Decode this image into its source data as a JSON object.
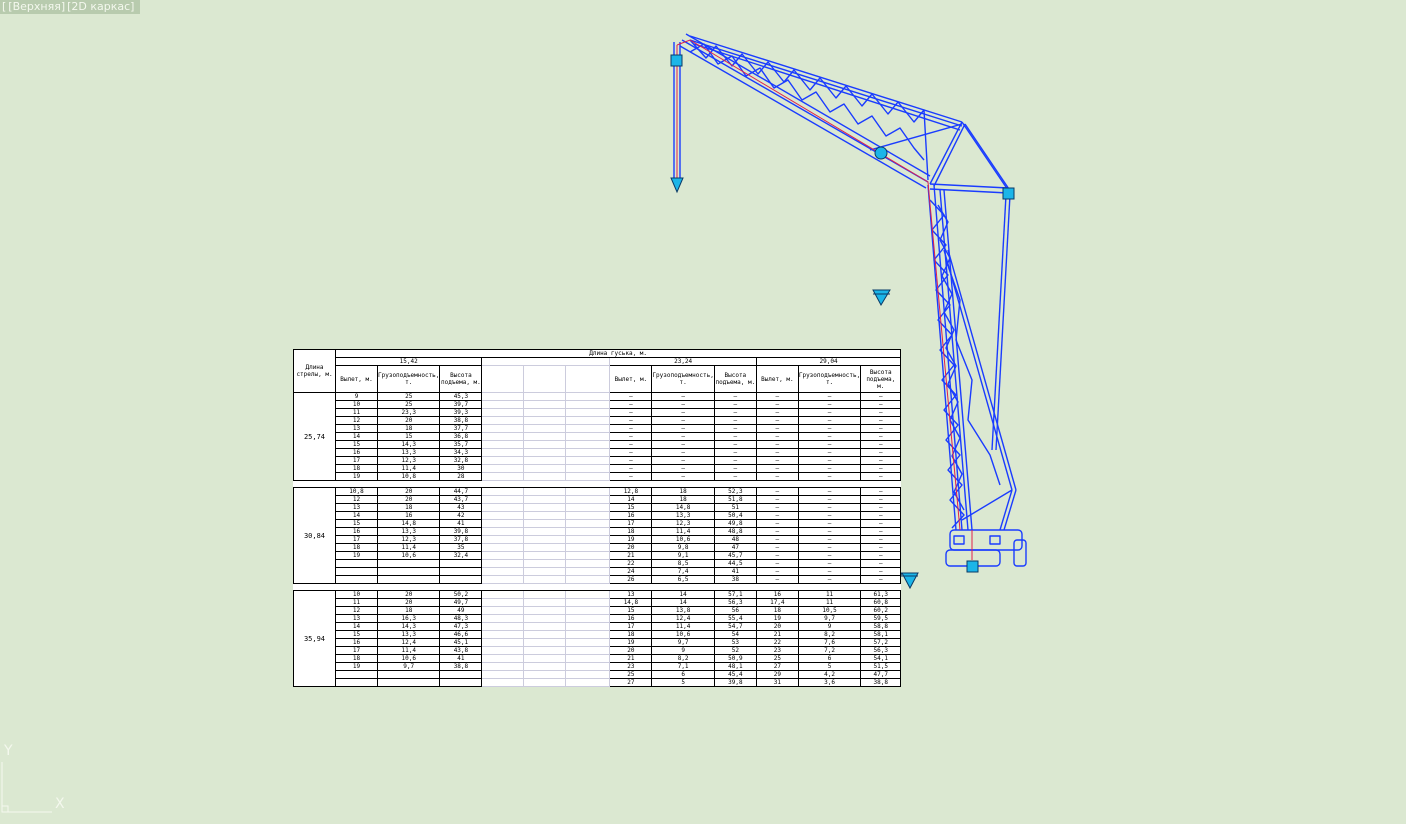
{
  "viewport": {
    "prefix": "[",
    "view": "[Верхняя]",
    "style": "[2D каркас]"
  },
  "colors": {
    "background": "#dbe8d1",
    "crane_lines": "#1a3cff",
    "cable": "#e0204a",
    "markers": "#1bb5e8"
  },
  "table": {
    "col1_header": "Длина стрелы, м.",
    "top_header": "Длина гуська, м.",
    "jib_lengths": [
      "15,42",
      "23,24",
      "29,04"
    ],
    "sub_headers": [
      "Вылет, м.",
      "Грузоподъемность, т.",
      "Высота подъема, м."
    ],
    "groups": [
      {
        "boom": "25,74",
        "rows": [
          [
            "9",
            "25",
            "45,3",
            "—",
            "—",
            "—",
            "—",
            "—",
            "—"
          ],
          [
            "10",
            "25",
            "39,7",
            "—",
            "—",
            "—",
            "—",
            "—",
            "—"
          ],
          [
            "11",
            "23,3",
            "39,3",
            "—",
            "—",
            "—",
            "—",
            "—",
            "—"
          ],
          [
            "12",
            "20",
            "38,8",
            "—",
            "—",
            "—",
            "—",
            "—",
            "—"
          ],
          [
            "13",
            "18",
            "37,7",
            "—",
            "—",
            "—",
            "—",
            "—",
            "—"
          ],
          [
            "14",
            "15",
            "36,8",
            "—",
            "—",
            "—",
            "—",
            "—",
            "—"
          ],
          [
            "15",
            "14,3",
            "35,7",
            "—",
            "—",
            "—",
            "—",
            "—",
            "—"
          ],
          [
            "16",
            "13,3",
            "34,3",
            "—",
            "—",
            "—",
            "—",
            "—",
            "—"
          ],
          [
            "17",
            "12,3",
            "32,8",
            "—",
            "—",
            "—",
            "—",
            "—",
            "—"
          ],
          [
            "18",
            "11,4",
            "30",
            "—",
            "—",
            "—",
            "—",
            "—",
            "—"
          ],
          [
            "19",
            "10,8",
            "28",
            "—",
            "—",
            "—",
            "—",
            "—",
            "—"
          ]
        ]
      },
      {
        "boom": "30,84",
        "rows": [
          [
            "10,8",
            "20",
            "44,7",
            "12,8",
            "18",
            "52,3",
            "—",
            "—",
            "—"
          ],
          [
            "12",
            "20",
            "43,7",
            "14",
            "18",
            "51,8",
            "—",
            "—",
            "—"
          ],
          [
            "13",
            "18",
            "43",
            "15",
            "14,8",
            "51",
            "—",
            "—",
            "—"
          ],
          [
            "14",
            "16",
            "42",
            "16",
            "13,3",
            "50,4",
            "—",
            "—",
            "—"
          ],
          [
            "15",
            "14,8",
            "41",
            "17",
            "12,3",
            "49,8",
            "—",
            "—",
            "—"
          ],
          [
            "16",
            "13,3",
            "39,8",
            "18",
            "11,4",
            "48,8",
            "—",
            "—",
            "—"
          ],
          [
            "17",
            "12,3",
            "37,8",
            "19",
            "10,6",
            "48",
            "—",
            "—",
            "—"
          ],
          [
            "18",
            "11,4",
            "35",
            "20",
            "9,8",
            "47",
            "—",
            "—",
            "—"
          ],
          [
            "19",
            "10,6",
            "32,4",
            "21",
            "9,1",
            "45,7",
            "—",
            "—",
            "—"
          ],
          [
            "",
            "",
            "",
            "22",
            "8,5",
            "44,5",
            "—",
            "—",
            "—"
          ],
          [
            "",
            "",
            "",
            "24",
            "7,4",
            "41",
            "—",
            "—",
            "—"
          ],
          [
            "",
            "",
            "",
            "26",
            "6,5",
            "38",
            "—",
            "—",
            "—"
          ]
        ]
      },
      {
        "boom": "35,94",
        "rows": [
          [
            "10",
            "20",
            "50,2",
            "13",
            "14",
            "57,1",
            "16",
            "11",
            "61,3"
          ],
          [
            "11",
            "20",
            "49,7",
            "14,8",
            "14",
            "56,3",
            "17,4",
            "11",
            "60,8"
          ],
          [
            "12",
            "18",
            "49",
            "15",
            "13,8",
            "56",
            "18",
            "10,5",
            "60,2"
          ],
          [
            "13",
            "16,3",
            "48,3",
            "16",
            "12,4",
            "55,4",
            "19",
            "9,7",
            "59,5"
          ],
          [
            "14",
            "14,3",
            "47,3",
            "17",
            "11,4",
            "54,7",
            "20",
            "9",
            "58,8"
          ],
          [
            "15",
            "13,3",
            "46,6",
            "18",
            "10,6",
            "54",
            "21",
            "8,2",
            "58,1"
          ],
          [
            "16",
            "12,4",
            "45,1",
            "19",
            "9,7",
            "53",
            "22",
            "7,6",
            "57,2"
          ],
          [
            "17",
            "11,4",
            "43,8",
            "20",
            "9",
            "52",
            "23",
            "7,2",
            "56,3"
          ],
          [
            "18",
            "10,6",
            "41",
            "21",
            "8,2",
            "50,9",
            "25",
            "6",
            "54,1"
          ],
          [
            "19",
            "9,7",
            "38,8",
            "23",
            "7,1",
            "48,1",
            "27",
            "5",
            "51,5"
          ],
          [
            "",
            "",
            "",
            "25",
            "6",
            "45,4",
            "29",
            "4,2",
            "47,7"
          ],
          [
            "",
            "",
            "",
            "27",
            "5",
            "39,8",
            "31",
            "3,6",
            "38,8"
          ]
        ]
      }
    ]
  },
  "ucs": {
    "y_label": "Y",
    "x_label": "X"
  }
}
